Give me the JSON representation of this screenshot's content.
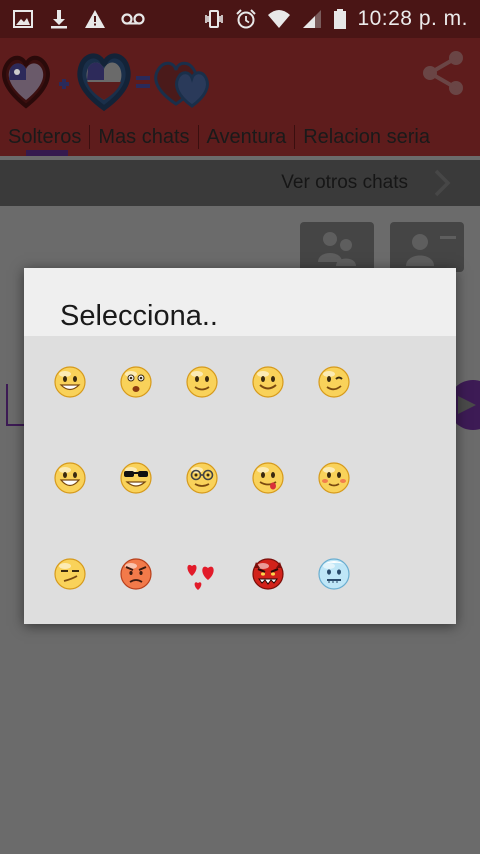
{
  "status_bar": {
    "time": "10:28 p. m.",
    "left_icons": [
      "image-icon",
      "download-icon",
      "warning-icon",
      "voicemail-icon"
    ],
    "right_icons": [
      "vibrate-icon",
      "alarm-icon",
      "wifi-icon",
      "signal-icon",
      "battery-icon"
    ]
  },
  "header": {
    "logo_icons": [
      "heart-chile-flag-icon",
      "plus-icon",
      "heart-chile-flag-icon",
      "equals-icon",
      "two-hearts-icon"
    ],
    "share_icon": "share-icon",
    "tabs": [
      {
        "label": "Solteros"
      },
      {
        "label": "Mas chats"
      },
      {
        "label": "Aventura"
      },
      {
        "label": "Relacion seria"
      }
    ]
  },
  "sub_bar": {
    "label": "Ver otros chats"
  },
  "dialog": {
    "title": "Selecciona..",
    "emojis": [
      [
        "grin-emoji",
        "surprised-emoji",
        "smile-emoji",
        "happy-emoji",
        "wink-emoji"
      ],
      [
        "big-smile-emoji",
        "sunglasses-emoji",
        "glasses-emoji",
        "tongue-emoji",
        "blush-emoji"
      ],
      [
        "smirk-emoji",
        "angry-emoji",
        "hearts-emoji",
        "devil-emoji",
        "frozen-emoji"
      ]
    ]
  },
  "colors": {
    "status_bar": "#4a1515",
    "header": "#5e1c1c",
    "tab_indicator": "#351a4e",
    "dialog_bg": "#dedede",
    "dialog_head": "#efefef",
    "overlay_bg": "#6b6b6b"
  }
}
